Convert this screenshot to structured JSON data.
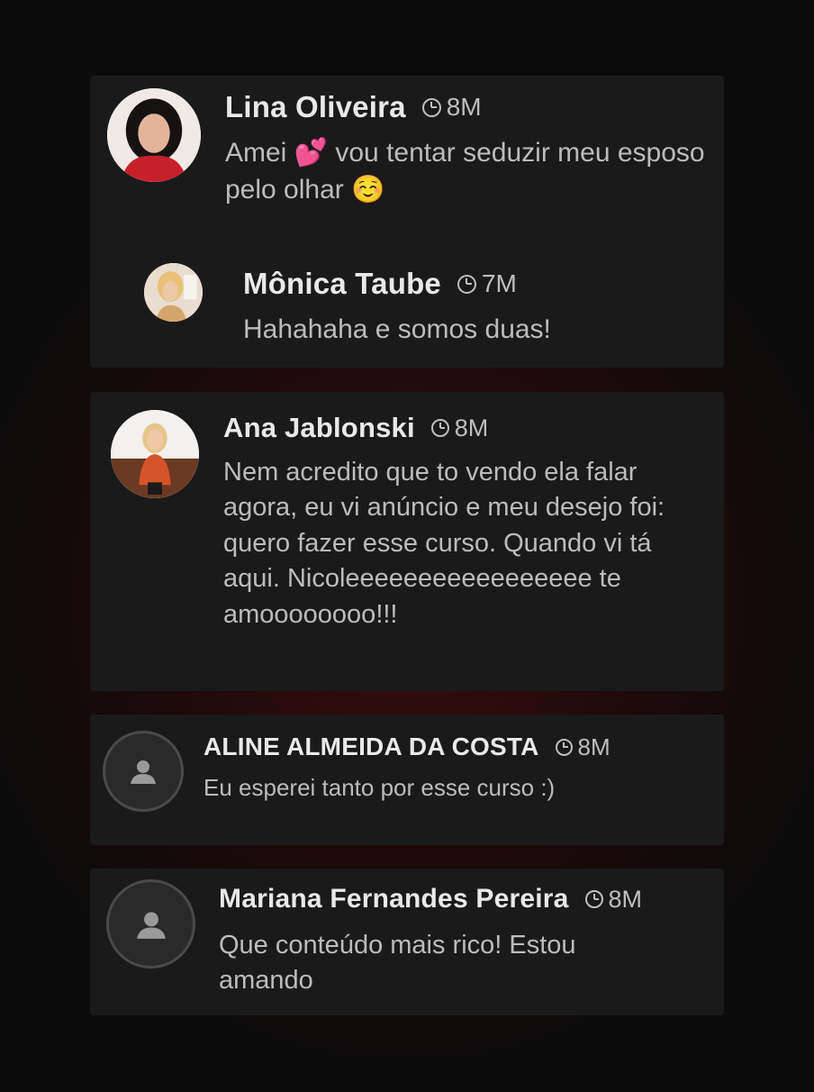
{
  "comments": [
    {
      "name": "Lina Oliveira",
      "time": "8M",
      "text": "Amei 💕 vou tentar seduzir meu esposo pelo olhar ☺️",
      "reply": {
        "name": "Mônica Taube",
        "time": "7M",
        "text": "Hahahaha e somos duas!"
      }
    },
    {
      "name": "Ana Jablonski",
      "time": "8M",
      "text": "Nem acredito que to vendo ela falar agora, eu vi anúncio e meu desejo foi: quero fazer esse curso. Quando vi tá aqui. Nicoleeeeeeeeeeeeeeeee te amoooooooo!!!"
    },
    {
      "name": "ALINE ALMEIDA DA COSTA",
      "time": "8M",
      "text": "Eu esperei tanto por esse curso :)"
    },
    {
      "name": "Mariana Fernandes Pereira",
      "time": "8M",
      "text": "Que conteúdo mais rico! Estou amando"
    }
  ],
  "icons": {
    "clock": "clock-icon",
    "placeholder": "user-placeholder-icon"
  },
  "colors": {
    "card": "#1a1a1a",
    "name": "#e9e9e9",
    "text": "#bcbcbc"
  }
}
